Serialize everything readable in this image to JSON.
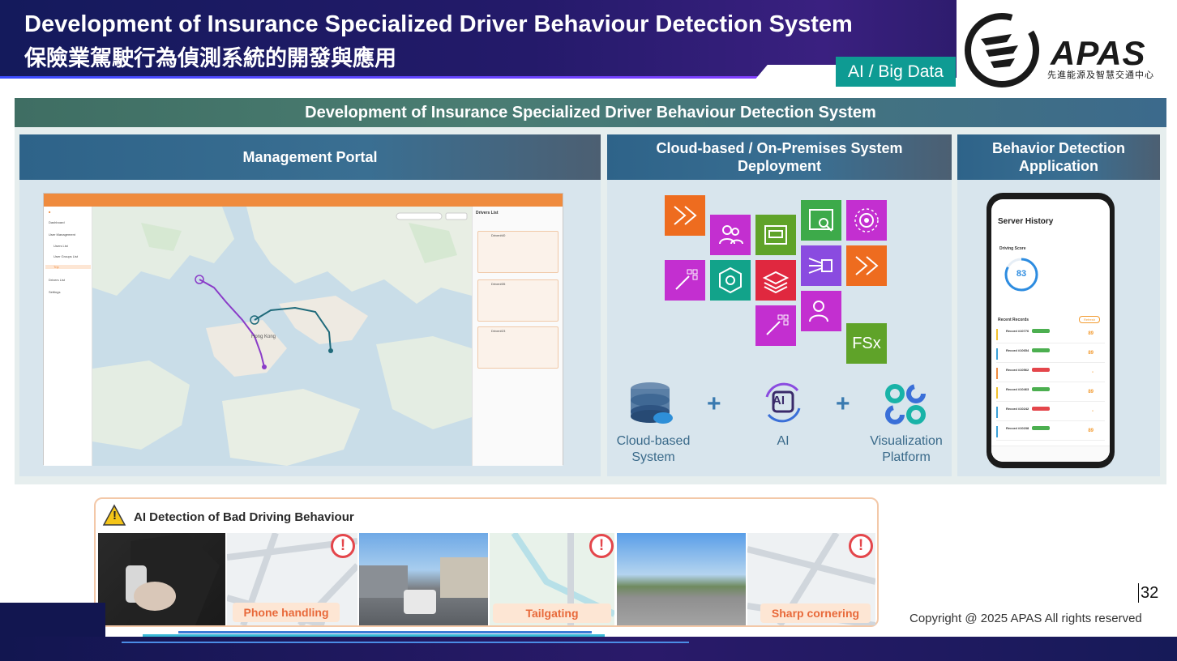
{
  "header": {
    "title_en": "Development of Insurance Specialized Driver Behaviour Detection System",
    "title_zh": "保險業駕駛行為偵測系統的開發與應用",
    "tag": "AI / Big Data"
  },
  "logo": {
    "name": "APAS",
    "subtitle": "先進能源及智慧交通中心"
  },
  "banner": "Development of Insurance Specialized Driver Behaviour Detection System",
  "columns": {
    "portal": {
      "title": "Management Portal"
    },
    "cloud": {
      "title": "Cloud-based / On-Premises System Deployment"
    },
    "app": {
      "title": "Behavior Detection Application"
    }
  },
  "portal": {
    "sidebar": [
      "Dashboard",
      "User Management",
      "Users List",
      "User Groups List",
      "Trip",
      "Drivers List",
      "Settings"
    ],
    "list_title": "Drivers List",
    "drivers": [
      "Driver#40",
      "Driver#35",
      "Driver#23"
    ],
    "map_city": "Hong Kong"
  },
  "cloud": {
    "fsx_label": "FSx",
    "items": [
      {
        "label_1": "Cloud-based",
        "label_2": "System"
      },
      {
        "label_1": "AI",
        "label_2": ""
      },
      {
        "label_1": "Visualization",
        "label_2": "Platform"
      }
    ],
    "ai_glyph": "AI",
    "plus": "+"
  },
  "app": {
    "screen_title": "Server History",
    "driving_score_label": "Driving Score",
    "driving_score": "83",
    "recent_label": "Recent Records",
    "refresh_label": "Refresh",
    "records": [
      {
        "id": "Record #10776",
        "score": "89",
        "color": "#f2c12e"
      },
      {
        "id": "Record #10654",
        "score": "89",
        "color": "#f2c12e"
      },
      {
        "id": "Record #10562",
        "score": "-",
        "color": "#e4464b"
      },
      {
        "id": "Record #10463",
        "score": "89",
        "color": "#f2c12e"
      },
      {
        "id": "Record #10242",
        "score": "-",
        "color": "#3aa0d8"
      },
      {
        "id": "Record #10238",
        "score": "89",
        "color": "#3aa0d8"
      }
    ]
  },
  "ai_detection": {
    "title": "AI Detection of Bad Driving Behaviour",
    "captions": [
      "Phone handling",
      "Tailgating",
      "Sharp cornering"
    ],
    "alert_glyph": "!",
    "warning_glyph": "!"
  },
  "footer": {
    "page": "32",
    "copyright": "Copyright @ 2025 APAS All rights reserved"
  },
  "colors": {
    "accent_teal": "#0e9b93",
    "banner_green": "#3f6e63",
    "header_blue": "#2e6389",
    "alert_red": "#e4464b",
    "caption_orange": "#e8693a"
  }
}
